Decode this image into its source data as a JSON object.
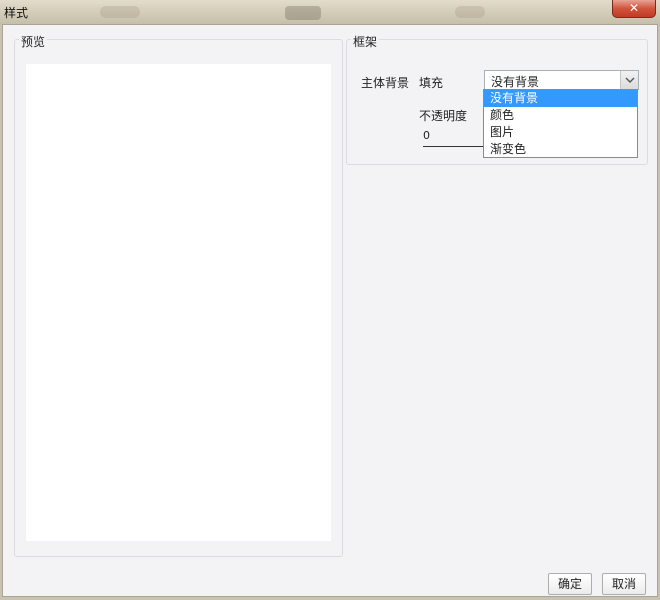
{
  "window": {
    "title": "样式",
    "close_symbol": "✕"
  },
  "preview": {
    "legend": "预览"
  },
  "frame": {
    "legend": "框架",
    "body_background_label": "主体背景",
    "fill_label": "填充",
    "fill_value": "没有背景",
    "opacity_label": "不透明度",
    "opacity_value": "0"
  },
  "dropdown": {
    "options": [
      "没有背景",
      "颜色",
      "图片",
      "渐变色"
    ],
    "selected_index": 0
  },
  "buttons": {
    "ok": "确定",
    "cancel": "取消"
  }
}
